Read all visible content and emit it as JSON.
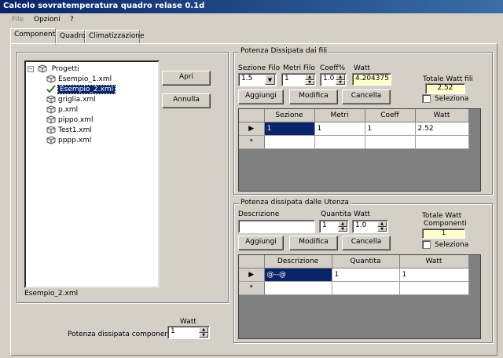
{
  "window": {
    "title": "Calcolo sovratemperatura quadro relase 0.1d"
  },
  "menu": {
    "file": "File",
    "opzioni": "Opzioni",
    "help": "?"
  },
  "tabs": {
    "componenti": "Componenti",
    "quadro": "Quadro",
    "climatizzazione": "Climatizzazione"
  },
  "tree": {
    "root": "Progetti",
    "items": [
      "Esempio_1.xml",
      "Esempio_2.xml",
      "griglia.xml",
      "p.xml",
      "pippo.xml",
      "Test1.xml",
      "pppp.xml"
    ],
    "selected_index": 1
  },
  "buttons": {
    "apri": "Apri",
    "annulla": "Annulla"
  },
  "status_file": "Esempio_2.xml",
  "potenza_componenti": {
    "label": "Potenza dissipata componenti",
    "watt_label": "Watt",
    "value": "1"
  },
  "fili": {
    "group_title": "Potenza Dissipata dai fili",
    "sezione_label": "Sezione Filo",
    "sezione_value": "1.5",
    "metri_label": "Metri Filo",
    "metri_value": "1",
    "coeff_label": "Coeff%",
    "coeff_value": "1.0",
    "watt_label": "Watt",
    "watt_value": "4.204375",
    "totale_label": "Totale Watt fili",
    "totale_value": "2.52",
    "seleziona_label": "Seleziona",
    "aggiungi": "Aggiungi",
    "modifica": "Modifica",
    "cancella": "Cancella",
    "columns": [
      "Sezione",
      "Metri",
      "Coeff",
      "Watt"
    ],
    "rows": [
      [
        "1",
        "1",
        "1",
        "2.52"
      ]
    ],
    "new_row_marker": "*"
  },
  "utenza": {
    "group_title": "Potenza dissipata dalle Utenza",
    "descrizione_label": "Descrizione",
    "descrizione_value": "",
    "quantita_label": "Quantita",
    "quantita_value": "1",
    "watt_label": "Watt",
    "watt_value": "1.0",
    "totale_label_1": "Totale Watt",
    "totale_label_2": "Componenti",
    "totale_value": "1",
    "seleziona_label": "Seleziona",
    "aggiungi": "Aggiungi",
    "modifica": "Modifica",
    "cancella": "Cancella",
    "columns": [
      "Descrizione",
      "Quantita",
      "Watt"
    ],
    "rows": [
      [
        "@--@",
        "1",
        "1"
      ]
    ],
    "new_row_marker": "*"
  },
  "colors": {
    "title_start": "#0a246a",
    "title_end": "#3a6ea5",
    "face": "#d4d0c8",
    "selection": "#0a246a",
    "highlight_field": "#ffffcc"
  }
}
